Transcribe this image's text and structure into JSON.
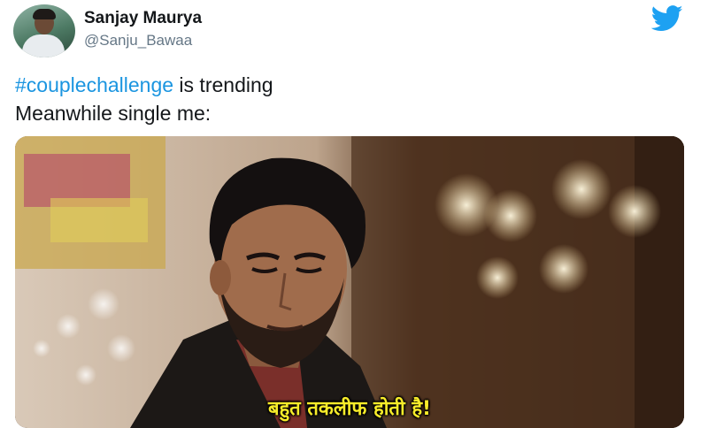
{
  "author": {
    "display_name": "Sanjay Maurya",
    "handle": "@Sanju_Bawaa"
  },
  "icons": {
    "platform": "twitter-bird-icon",
    "platform_color": "#1da1f2"
  },
  "tweet": {
    "hashtag": "#couplechallenge",
    "line1_rest": " is trending",
    "line2": "Meanwhile single me:"
  },
  "media": {
    "subtitle": "बहुत तकलीफ होती है!"
  },
  "colors": {
    "hashtag": "#1b95e0",
    "subtitle": "#f7ec2a",
    "text": "#14171a",
    "secondary": "#657786"
  }
}
